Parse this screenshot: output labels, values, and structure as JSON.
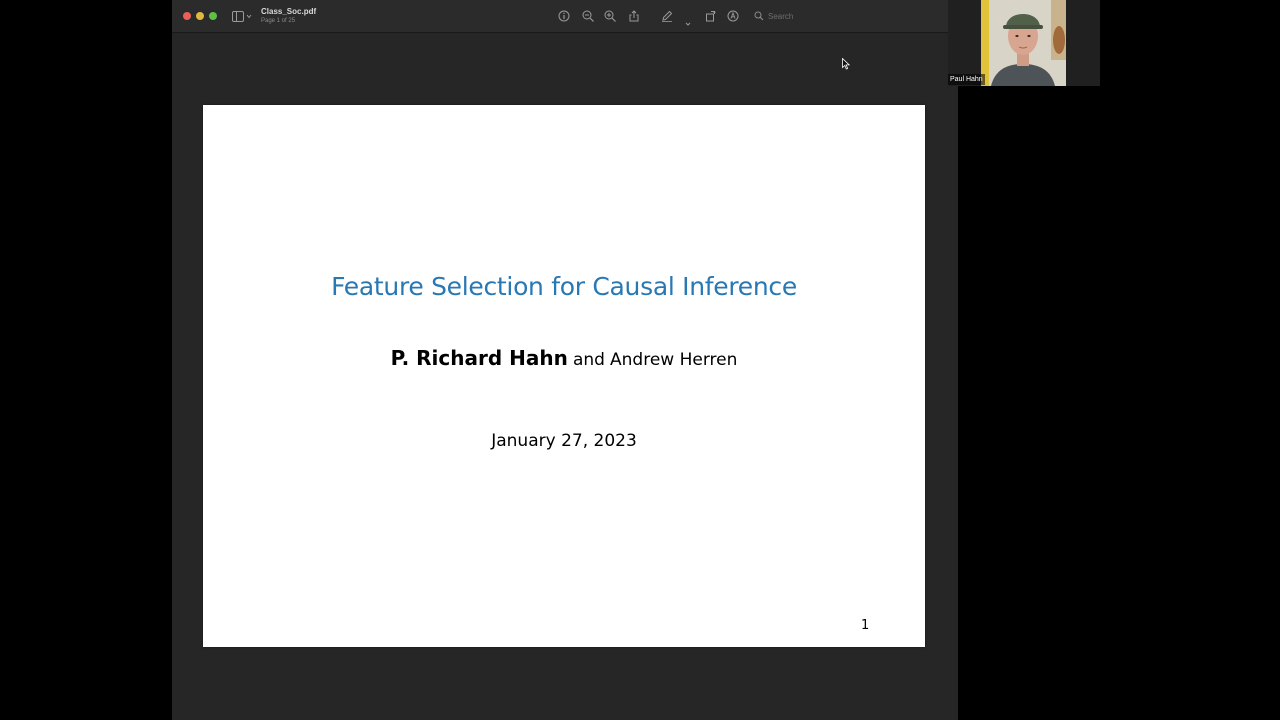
{
  "viewer": {
    "file_name": "Class_Soc.pdf",
    "page_indicator": "Page 1 of 25",
    "search_placeholder": "Search"
  },
  "toolbar_icons": [
    "sidebar-icon",
    "info-icon",
    "zoom-out-icon",
    "zoom-in-icon",
    "share-icon",
    "markup-pen-icon",
    "rotate-icon",
    "annotate-icon",
    "search-icon"
  ],
  "slide": {
    "title": "Feature Selection for Causal Inference",
    "author_primary": "P. Richard Hahn",
    "author_connector": "and",
    "author_secondary": "Andrew Herren",
    "date": "January 27, 2023",
    "page_number": "1"
  },
  "video": {
    "participant_name": "Paul Hahn"
  },
  "colors": {
    "slide_title": "#2878b4",
    "window_background": "#262626",
    "toolbar": "#2b2b2b",
    "close": "#ec5f57",
    "minimize": "#e0b83f",
    "maximize": "#5cc144"
  }
}
